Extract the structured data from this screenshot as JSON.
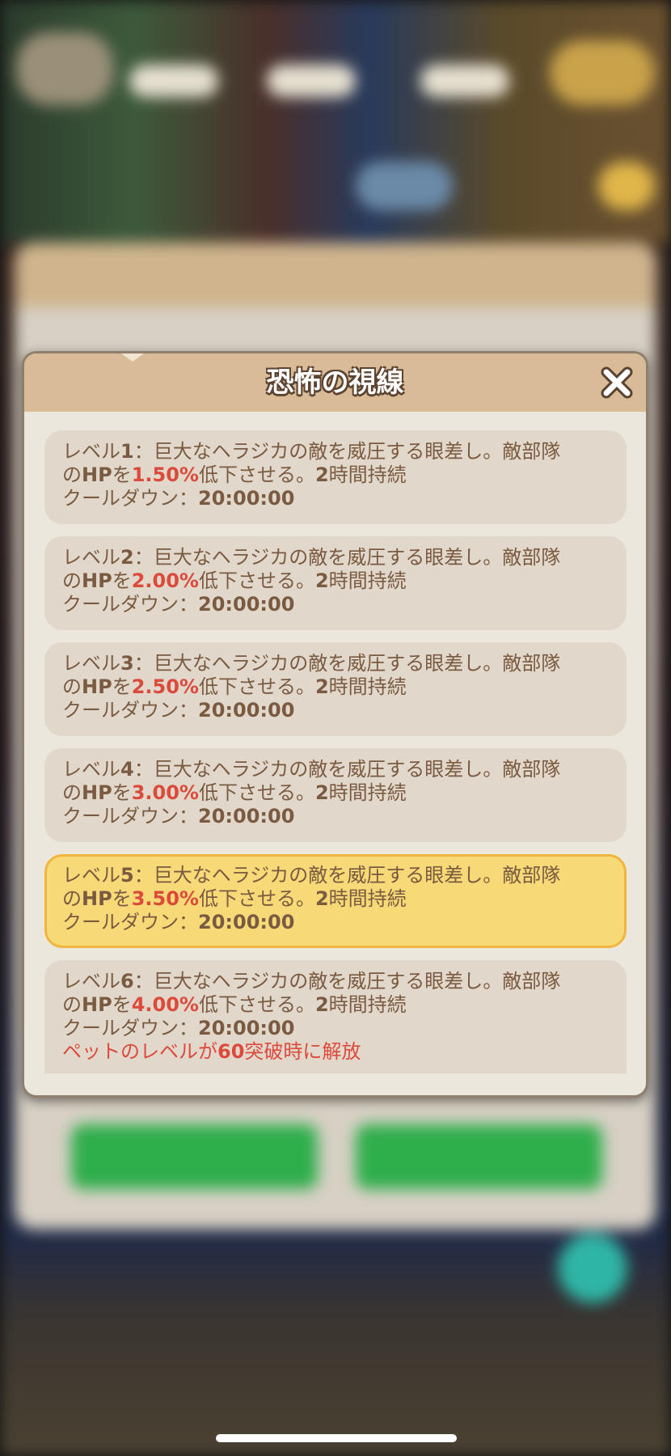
{
  "modal": {
    "title": "恐怖の視線",
    "close_icon": "close-x-icon"
  },
  "levels": [
    {
      "label": "レベル",
      "num": "1",
      "desc_a": "：巨大なヘラジカの敵を威圧する眼差し。敵部隊",
      "desc_b": "の",
      "hp": "HP",
      "wo": "を",
      "pct": "1.50%",
      "desc_c": "低下させる。",
      "hours": "2",
      "desc_d": "時間持続",
      "cooldown_label": "クールダウン：",
      "cooldown": "20:00:00"
    },
    {
      "label": "レベル",
      "num": "2",
      "desc_a": "：巨大なヘラジカの敵を威圧する眼差し。敵部隊",
      "desc_b": "の",
      "hp": "HP",
      "wo": "を",
      "pct": "2.00%",
      "desc_c": "低下させる。",
      "hours": "2",
      "desc_d": "時間持続",
      "cooldown_label": "クールダウン：",
      "cooldown": "20:00:00"
    },
    {
      "label": "レベル",
      "num": "3",
      "desc_a": "：巨大なヘラジカの敵を威圧する眼差し。敵部隊",
      "desc_b": "の",
      "hp": "HP",
      "wo": "を",
      "pct": "2.50%",
      "desc_c": "低下させる。",
      "hours": "2",
      "desc_d": "時間持続",
      "cooldown_label": "クールダウン：",
      "cooldown": "20:00:00"
    },
    {
      "label": "レベル",
      "num": "4",
      "desc_a": "：巨大なヘラジカの敵を威圧する眼差し。敵部隊",
      "desc_b": "の",
      "hp": "HP",
      "wo": "を",
      "pct": "3.00%",
      "desc_c": "低下させる。",
      "hours": "2",
      "desc_d": "時間持続",
      "cooldown_label": "クールダウン：",
      "cooldown": "20:00:00"
    },
    {
      "label": "レベル",
      "num": "5",
      "desc_a": "：巨大なヘラジカの敵を威圧する眼差し。敵部隊",
      "desc_b": "の",
      "hp": "HP",
      "wo": "を",
      "pct": "3.50%",
      "desc_c": "低下させる。",
      "hours": "2",
      "desc_d": "時間持続",
      "cooldown_label": "クールダウン：",
      "cooldown": "20:00:00"
    },
    {
      "label": "レベル",
      "num": "6",
      "desc_a": "：巨大なヘラジカの敵を威圧する眼差し。敵部隊",
      "desc_b": "の",
      "hp": "HP",
      "wo": "を",
      "pct": "4.00%",
      "desc_c": "低下させる。",
      "hours": "2",
      "desc_d": "時間持続",
      "cooldown_label": "クールダウン：",
      "cooldown": "20:00:00"
    }
  ],
  "unlock": {
    "prefix": "ペットのレベルが",
    "level": "60",
    "suffix": "突破時に解放"
  },
  "colors": {
    "header": "#d9bc97",
    "card": "#e1d8cb",
    "card_active": "#f7d977",
    "card_active_border": "#f0b53d",
    "text": "#7a5a40",
    "highlight": "#dc4a3c"
  }
}
